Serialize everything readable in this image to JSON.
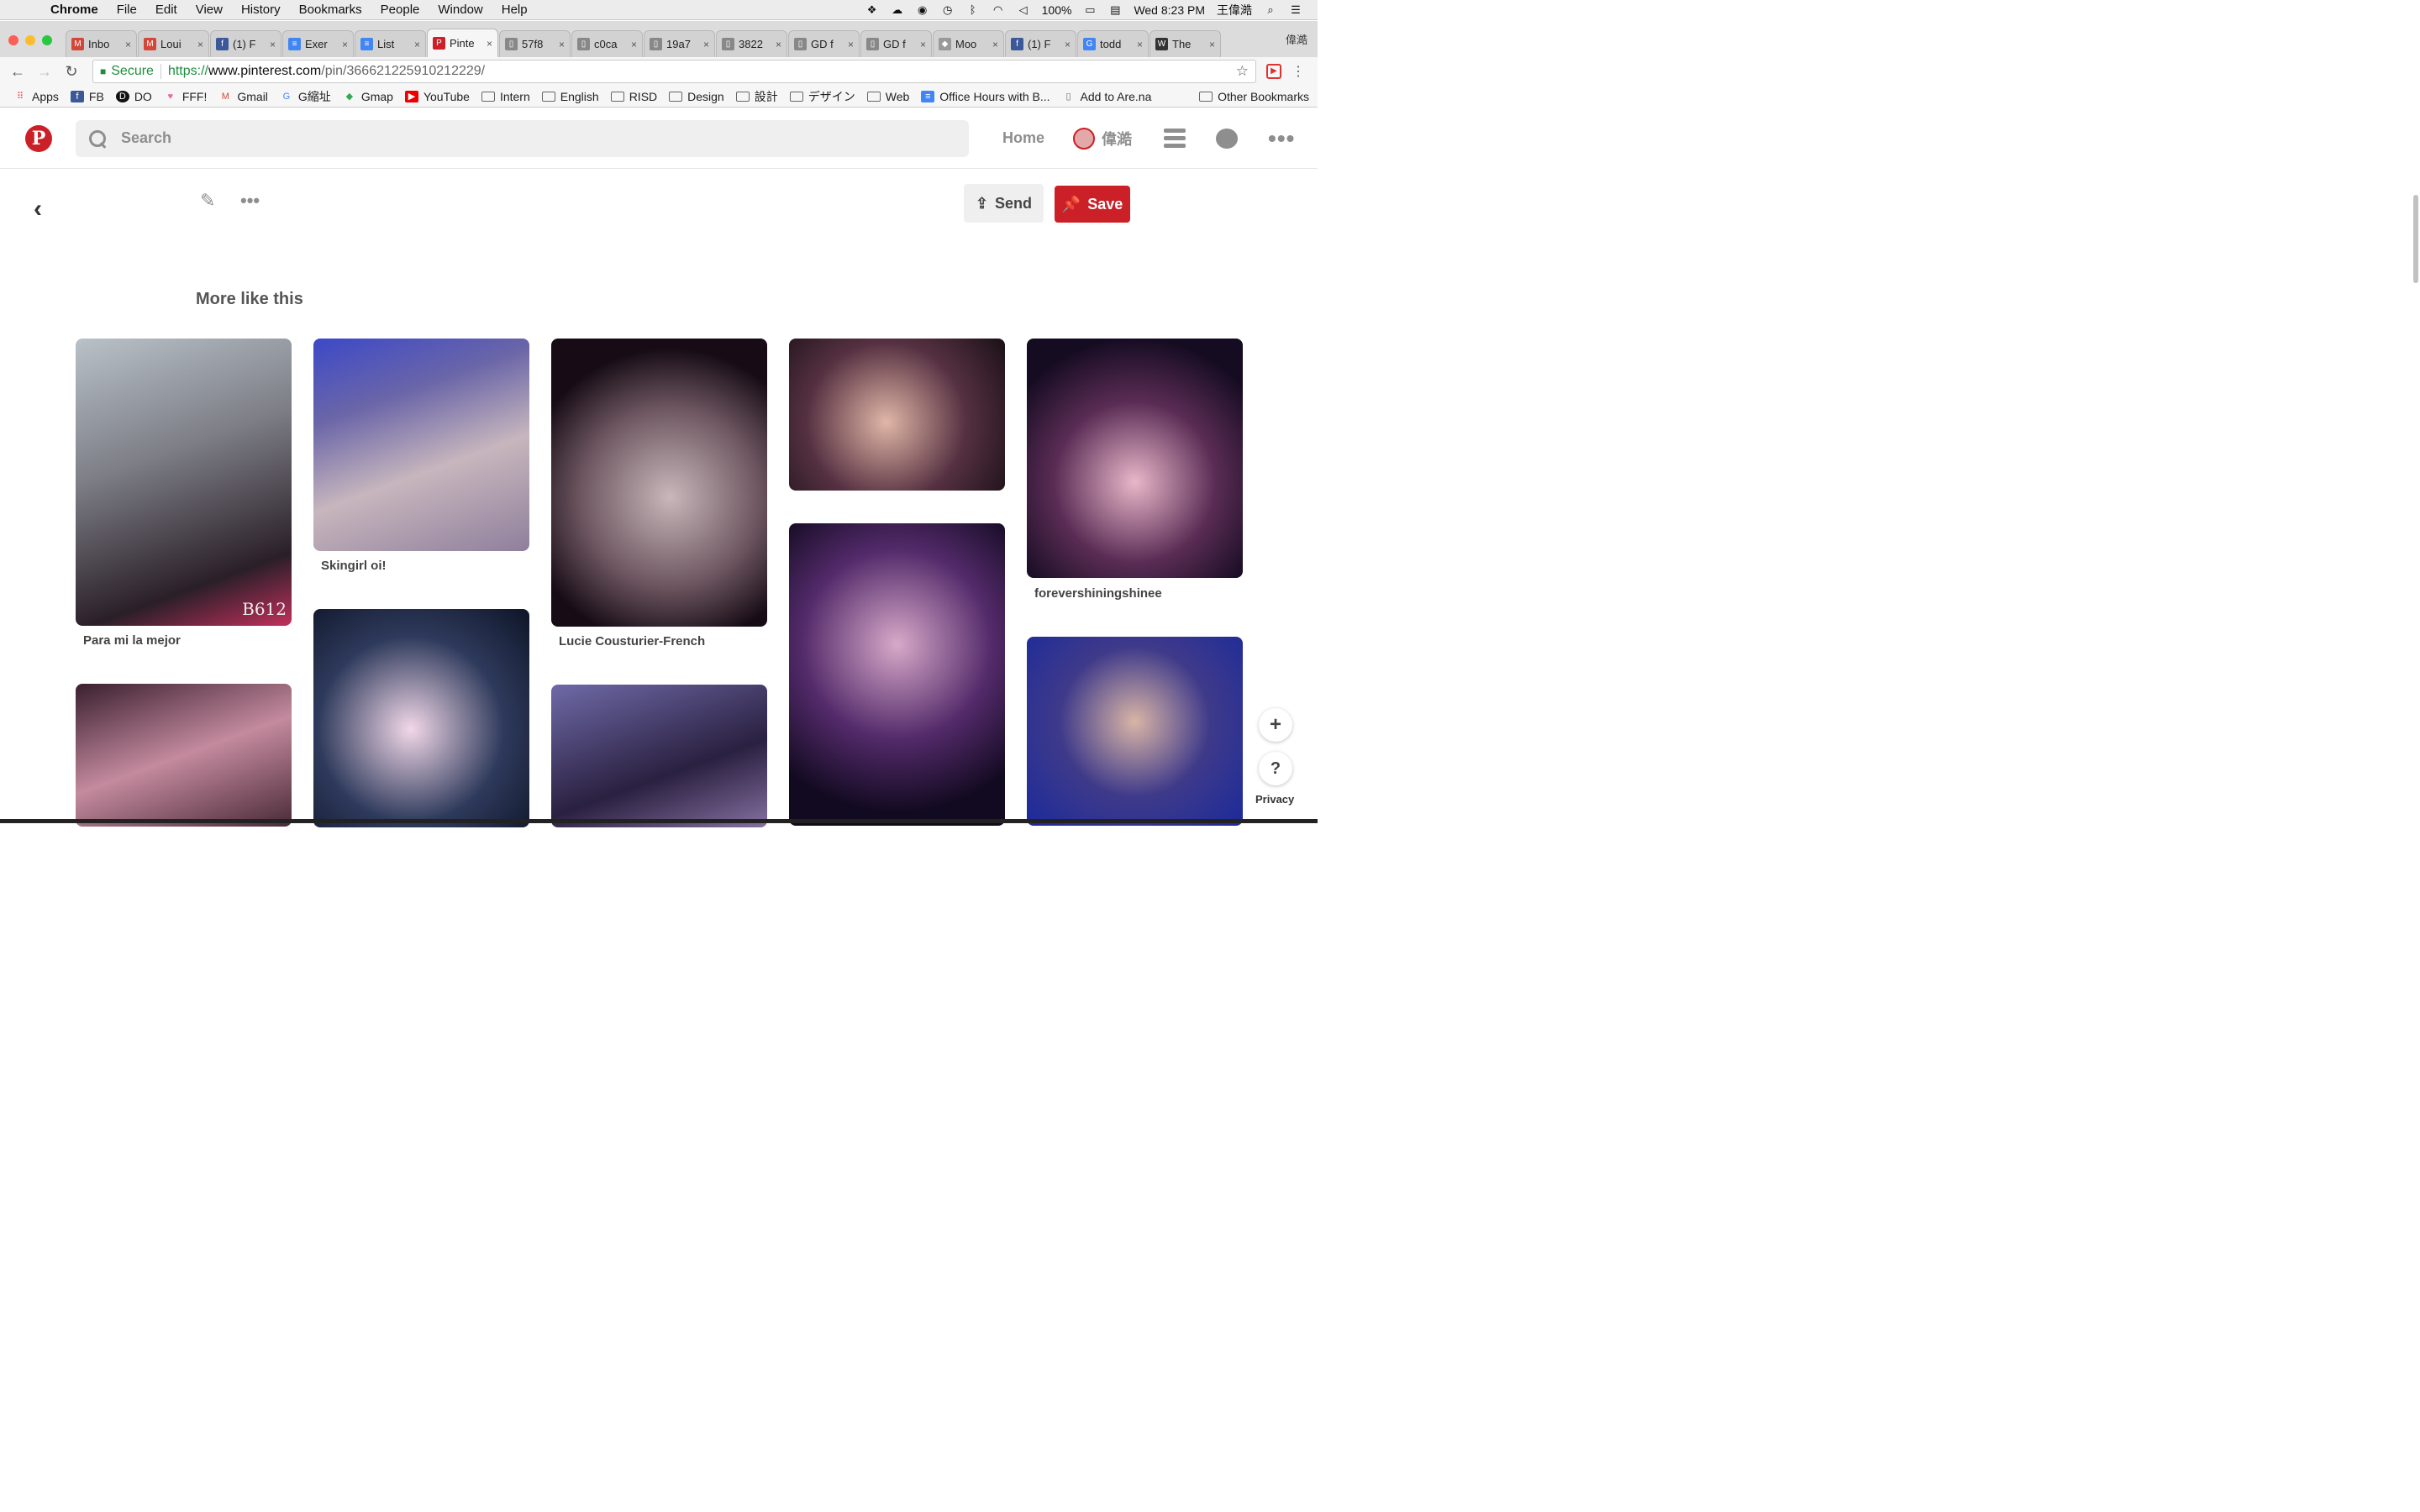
{
  "menubar": {
    "app": "Chrome",
    "items": [
      "File",
      "Edit",
      "View",
      "History",
      "Bookmarks",
      "People",
      "Window",
      "Help"
    ],
    "battery": "100%",
    "datetime": "Wed 8:23 PM",
    "user": "王偉澔"
  },
  "tabs": [
    {
      "title": "Inbo",
      "fav": "M",
      "color": "#d44638"
    },
    {
      "title": "Loui",
      "fav": "M",
      "color": "#d44638"
    },
    {
      "title": "(1) F",
      "fav": "f",
      "color": "#3b5998"
    },
    {
      "title": "Exer",
      "fav": "≡",
      "color": "#4285f4"
    },
    {
      "title": "List",
      "fav": "≡",
      "color": "#4285f4"
    },
    {
      "title": "Pinte",
      "fav": "P",
      "color": "#cb2027",
      "active": true
    },
    {
      "title": "57f8",
      "fav": "▯",
      "color": "#888"
    },
    {
      "title": "c0ca",
      "fav": "▯",
      "color": "#888"
    },
    {
      "title": "19a7",
      "fav": "▯",
      "color": "#888"
    },
    {
      "title": "3822",
      "fav": "▯",
      "color": "#888"
    },
    {
      "title": "GD f",
      "fav": "▯",
      "color": "#888"
    },
    {
      "title": "GD f",
      "fav": "▯",
      "color": "#888"
    },
    {
      "title": "Moo",
      "fav": "◆",
      "color": "#999"
    },
    {
      "title": "(1) F",
      "fav": "f",
      "color": "#3b5998"
    },
    {
      "title": "todd",
      "fav": "G",
      "color": "#4285f4"
    },
    {
      "title": "The",
      "fav": "W",
      "color": "#333"
    }
  ],
  "profile_name": "偉澔",
  "omnibox": {
    "secure_label": "Secure",
    "scheme": "https://",
    "domain": "www.pinterest.com",
    "path": "/pin/366621225910212229/"
  },
  "bookmarks": [
    {
      "label": "Apps",
      "type": "apps"
    },
    {
      "label": "FB",
      "type": "fb"
    },
    {
      "label": "DO",
      "type": "do"
    },
    {
      "label": "FFF!",
      "type": "fff"
    },
    {
      "label": "Gmail",
      "type": "gmail"
    },
    {
      "label": "G縮址",
      "type": "g"
    },
    {
      "label": "Gmap",
      "type": "gmap"
    },
    {
      "label": "YouTube",
      "type": "yt"
    },
    {
      "label": "Intern",
      "type": "folder"
    },
    {
      "label": "English",
      "type": "folder"
    },
    {
      "label": "RISD",
      "type": "folder"
    },
    {
      "label": "Design",
      "type": "folder"
    },
    {
      "label": "設計",
      "type": "folder"
    },
    {
      "label": "デザイン",
      "type": "folder"
    },
    {
      "label": "Web",
      "type": "folder"
    },
    {
      "label": "Office Hours with B...",
      "type": "doc"
    },
    {
      "label": "Add to Are.na",
      "type": "page"
    }
  ],
  "other_bookmarks": "Other Bookmarks",
  "pinterest": {
    "search_placeholder": "Search",
    "home": "Home",
    "user": "偉澔",
    "send": "Send",
    "save": "Save",
    "section_title": "More like this"
  },
  "pins": [
    {
      "title": "Para mi la mejor",
      "watermark": "B612"
    },
    {
      "title": "Skingirl oi!"
    },
    {
      "title": "Lucie Cousturier-French"
    },
    {
      "title": ""
    },
    {
      "title": "forevershiningshinee"
    },
    {
      "title": ""
    },
    {
      "title": ""
    },
    {
      "title": ""
    },
    {
      "title": ""
    },
    {
      "title": ""
    }
  ],
  "privacy": "Privacy",
  "colors": {
    "brand": "#cb2027",
    "muted": "#8e8e8e"
  }
}
